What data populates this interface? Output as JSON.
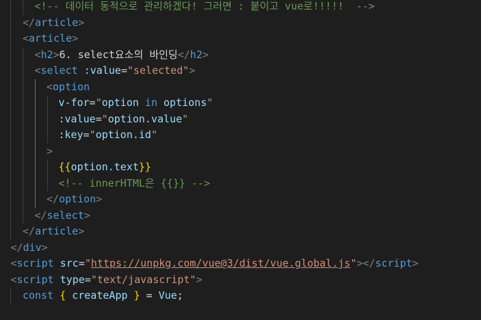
{
  "editor": {
    "lines": [
      {
        "indent": 3,
        "tokens": [
          {
            "t": "<!-- 데이터 동적으로 관리하겠다! 그러면 : 붙이고 vue로!!!!!  -->",
            "c": "c-cmt"
          }
        ]
      },
      {
        "indent": 2,
        "tokens": [
          {
            "t": "</",
            "c": "c-brk"
          },
          {
            "t": "article",
            "c": "c-tag"
          },
          {
            "t": ">",
            "c": "c-brk"
          }
        ]
      },
      {
        "indent": 2,
        "tokens": [
          {
            "t": "<",
            "c": "c-brk"
          },
          {
            "t": "article",
            "c": "c-tag"
          },
          {
            "t": ">",
            "c": "c-brk"
          }
        ]
      },
      {
        "indent": 3,
        "tokens": [
          {
            "t": "<",
            "c": "c-brk"
          },
          {
            "t": "h2",
            "c": "c-tag"
          },
          {
            "t": ">",
            "c": "c-brk"
          },
          {
            "t": "6. select요소의 바인딩",
            "c": "c-text"
          },
          {
            "t": "</",
            "c": "c-brk"
          },
          {
            "t": "h2",
            "c": "c-tag"
          },
          {
            "t": ">",
            "c": "c-brk"
          }
        ]
      },
      {
        "indent": 3,
        "tokens": [
          {
            "t": "<",
            "c": "c-brk"
          },
          {
            "t": "select",
            "c": "c-tag"
          },
          {
            "t": " :value",
            "c": "c-attr"
          },
          {
            "t": "=",
            "c": "c-op"
          },
          {
            "t": "\"selected\"",
            "c": "c-str"
          },
          {
            "t": ">",
            "c": "c-brk"
          }
        ]
      },
      {
        "indent": 4,
        "tokens": [
          {
            "t": "<",
            "c": "c-brk"
          },
          {
            "t": "option",
            "c": "c-tag"
          }
        ]
      },
      {
        "indent": 5,
        "tokens": [
          {
            "t": "v-for",
            "c": "c-attr"
          },
          {
            "t": "=",
            "c": "c-op"
          },
          {
            "t": "\"",
            "c": "c-str"
          },
          {
            "t": "option",
            "c": "c-var"
          },
          {
            "t": " in ",
            "c": "c-kw"
          },
          {
            "t": "options",
            "c": "c-var"
          },
          {
            "t": "\"",
            "c": "c-str"
          }
        ]
      },
      {
        "indent": 5,
        "tokens": [
          {
            "t": ":value",
            "c": "c-attr"
          },
          {
            "t": "=",
            "c": "c-op"
          },
          {
            "t": "\"",
            "c": "c-str"
          },
          {
            "t": "option.value",
            "c": "c-var"
          },
          {
            "t": "\"",
            "c": "c-str"
          }
        ]
      },
      {
        "indent": 5,
        "tokens": [
          {
            "t": ":key",
            "c": "c-attr"
          },
          {
            "t": "=",
            "c": "c-op"
          },
          {
            "t": "\"",
            "c": "c-str"
          },
          {
            "t": "option.id",
            "c": "c-var"
          },
          {
            "t": "\"",
            "c": "c-str"
          }
        ]
      },
      {
        "indent": 4,
        "tokens": [
          {
            "t": ">",
            "c": "c-brk"
          }
        ]
      },
      {
        "indent": 5,
        "tokens": [
          {
            "t": "{{",
            "c": "c-bold"
          },
          {
            "t": "option.text",
            "c": "c-var"
          },
          {
            "t": "}}",
            "c": "c-bold"
          }
        ]
      },
      {
        "indent": 5,
        "tokens": [
          {
            "t": "<!-- innerHTML은 {{}} -->",
            "c": "c-cmt"
          }
        ]
      },
      {
        "indent": 4,
        "tokens": [
          {
            "t": "</",
            "c": "c-brk"
          },
          {
            "t": "option",
            "c": "c-tag"
          },
          {
            "t": ">",
            "c": "c-brk"
          }
        ]
      },
      {
        "indent": 3,
        "tokens": [
          {
            "t": "</",
            "c": "c-brk"
          },
          {
            "t": "select",
            "c": "c-tag"
          },
          {
            "t": ">",
            "c": "c-brk"
          }
        ]
      },
      {
        "indent": 2,
        "tokens": [
          {
            "t": "</",
            "c": "c-brk"
          },
          {
            "t": "article",
            "c": "c-tag"
          },
          {
            "t": ">",
            "c": "c-brk"
          }
        ]
      },
      {
        "indent": 1,
        "tokens": [
          {
            "t": "</",
            "c": "c-brk"
          },
          {
            "t": "div",
            "c": "c-tag"
          },
          {
            "t": ">",
            "c": "c-brk"
          }
        ]
      },
      {
        "indent": 1,
        "tokens": [
          {
            "t": "<",
            "c": "c-brk"
          },
          {
            "t": "script",
            "c": "c-tag"
          },
          {
            "t": " src",
            "c": "c-attr"
          },
          {
            "t": "=",
            "c": "c-op"
          },
          {
            "t": "\"",
            "c": "c-str"
          },
          {
            "t": "https://unpkg.com/vue@3/dist/vue.global.js",
            "c": "c-link"
          },
          {
            "t": "\"",
            "c": "c-str"
          },
          {
            "t": "></",
            "c": "c-brk"
          },
          {
            "t": "script",
            "c": "c-tag"
          },
          {
            "t": ">",
            "c": "c-brk"
          }
        ]
      },
      {
        "indent": 1,
        "tokens": [
          {
            "t": "<",
            "c": "c-brk"
          },
          {
            "t": "script",
            "c": "c-tag"
          },
          {
            "t": " type",
            "c": "c-attr"
          },
          {
            "t": "=",
            "c": "c-op"
          },
          {
            "t": "\"text/javascript\"",
            "c": "c-str"
          },
          {
            "t": ">",
            "c": "c-brk"
          }
        ]
      },
      {
        "indent": 2,
        "tokens": [
          {
            "t": "const",
            "c": "c-kw"
          },
          {
            "t": " ",
            "c": "c-text"
          },
          {
            "t": "{",
            "c": "c-bold"
          },
          {
            "t": " createApp ",
            "c": "c-var"
          },
          {
            "t": "}",
            "c": "c-bold"
          },
          {
            "t": " = ",
            "c": "c-op"
          },
          {
            "t": "Vue",
            "c": "c-var"
          },
          {
            "t": ";",
            "c": "c-text"
          }
        ]
      }
    ]
  }
}
